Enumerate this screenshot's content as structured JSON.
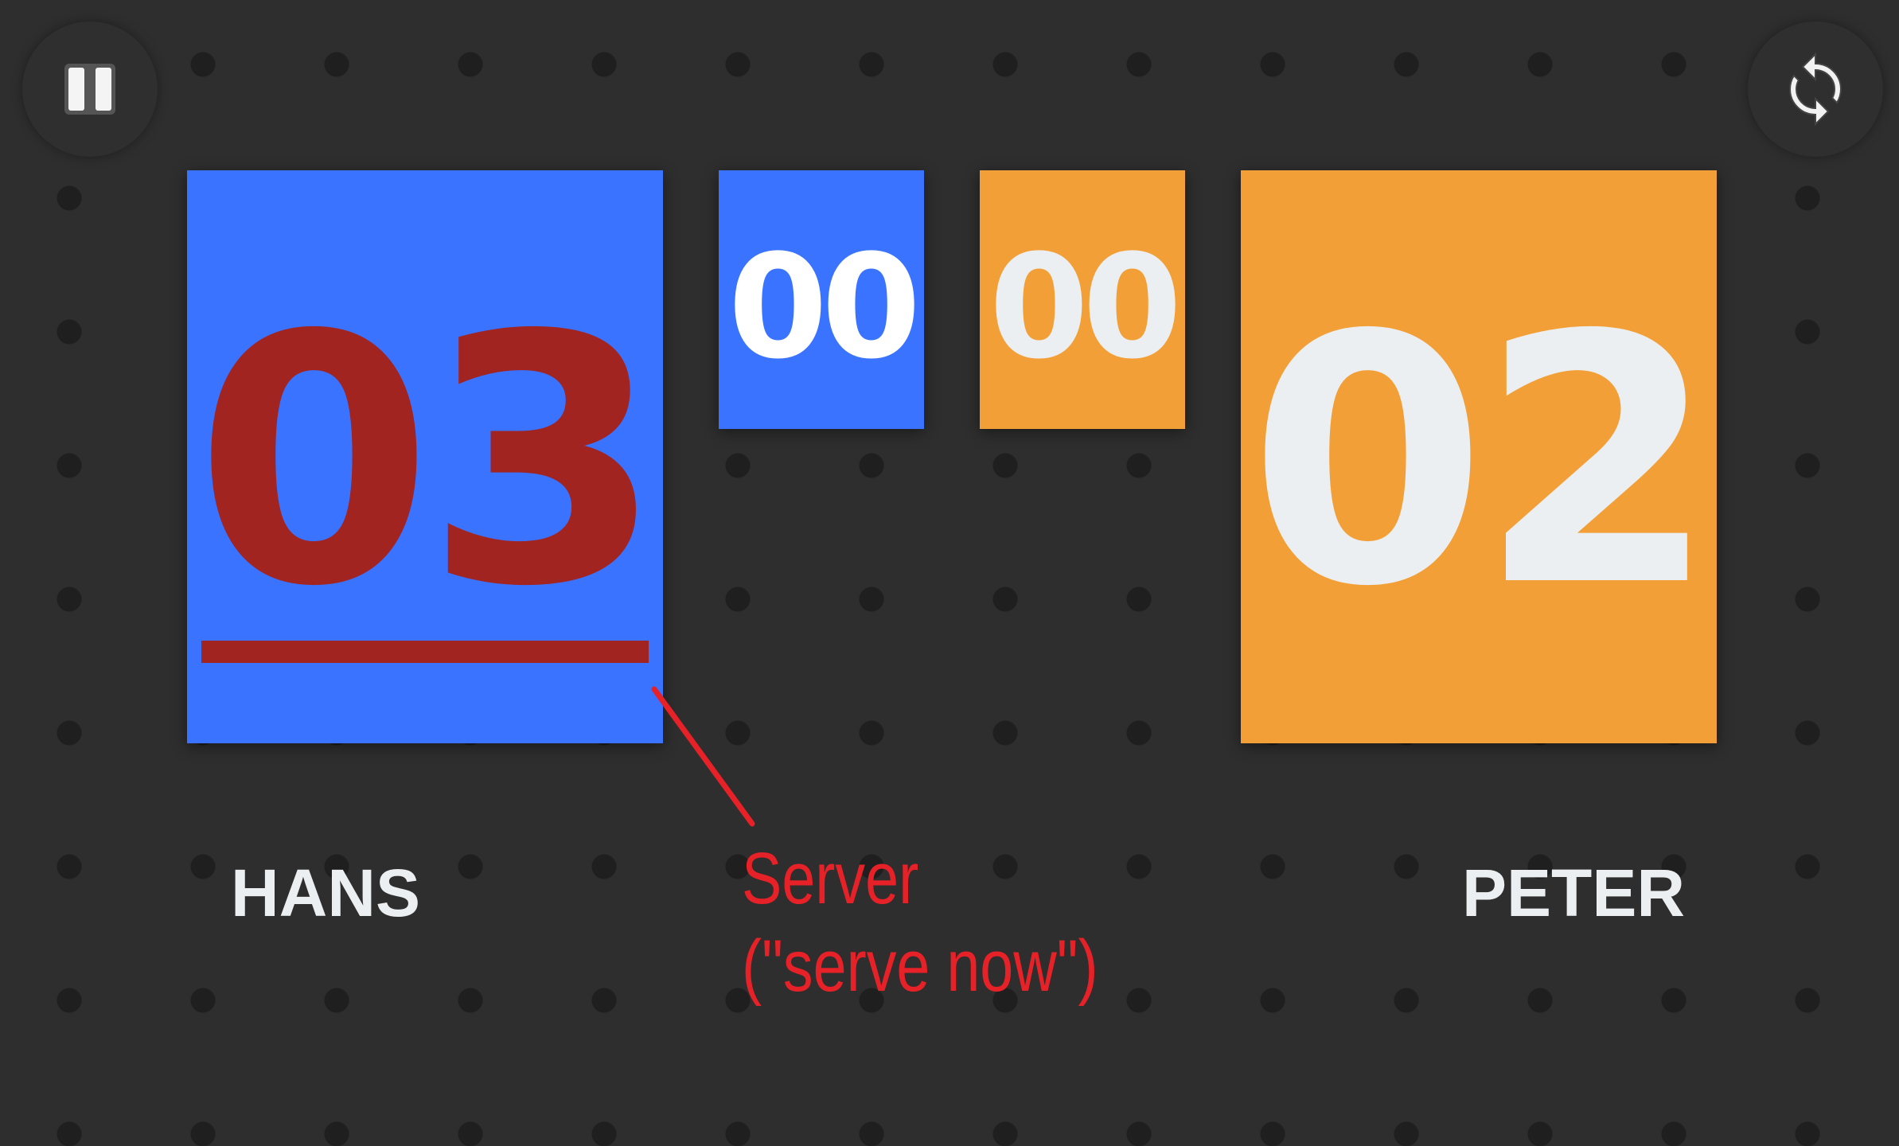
{
  "controls": {
    "pause_icon": "pause-icon",
    "reset_icon": "refresh-icon"
  },
  "left_player": {
    "name": "HANS",
    "score": "03",
    "games": "00",
    "color": "#3a73ff",
    "score_color": "#a12421",
    "is_server": true
  },
  "right_player": {
    "name": "PETER",
    "score": "02",
    "games": "00",
    "color": "#f39f37",
    "score_color": "#eceff1",
    "is_server": false
  },
  "annotation": {
    "line1": "Server",
    "line2": "(\"serve now\")",
    "color": "#e62127"
  }
}
